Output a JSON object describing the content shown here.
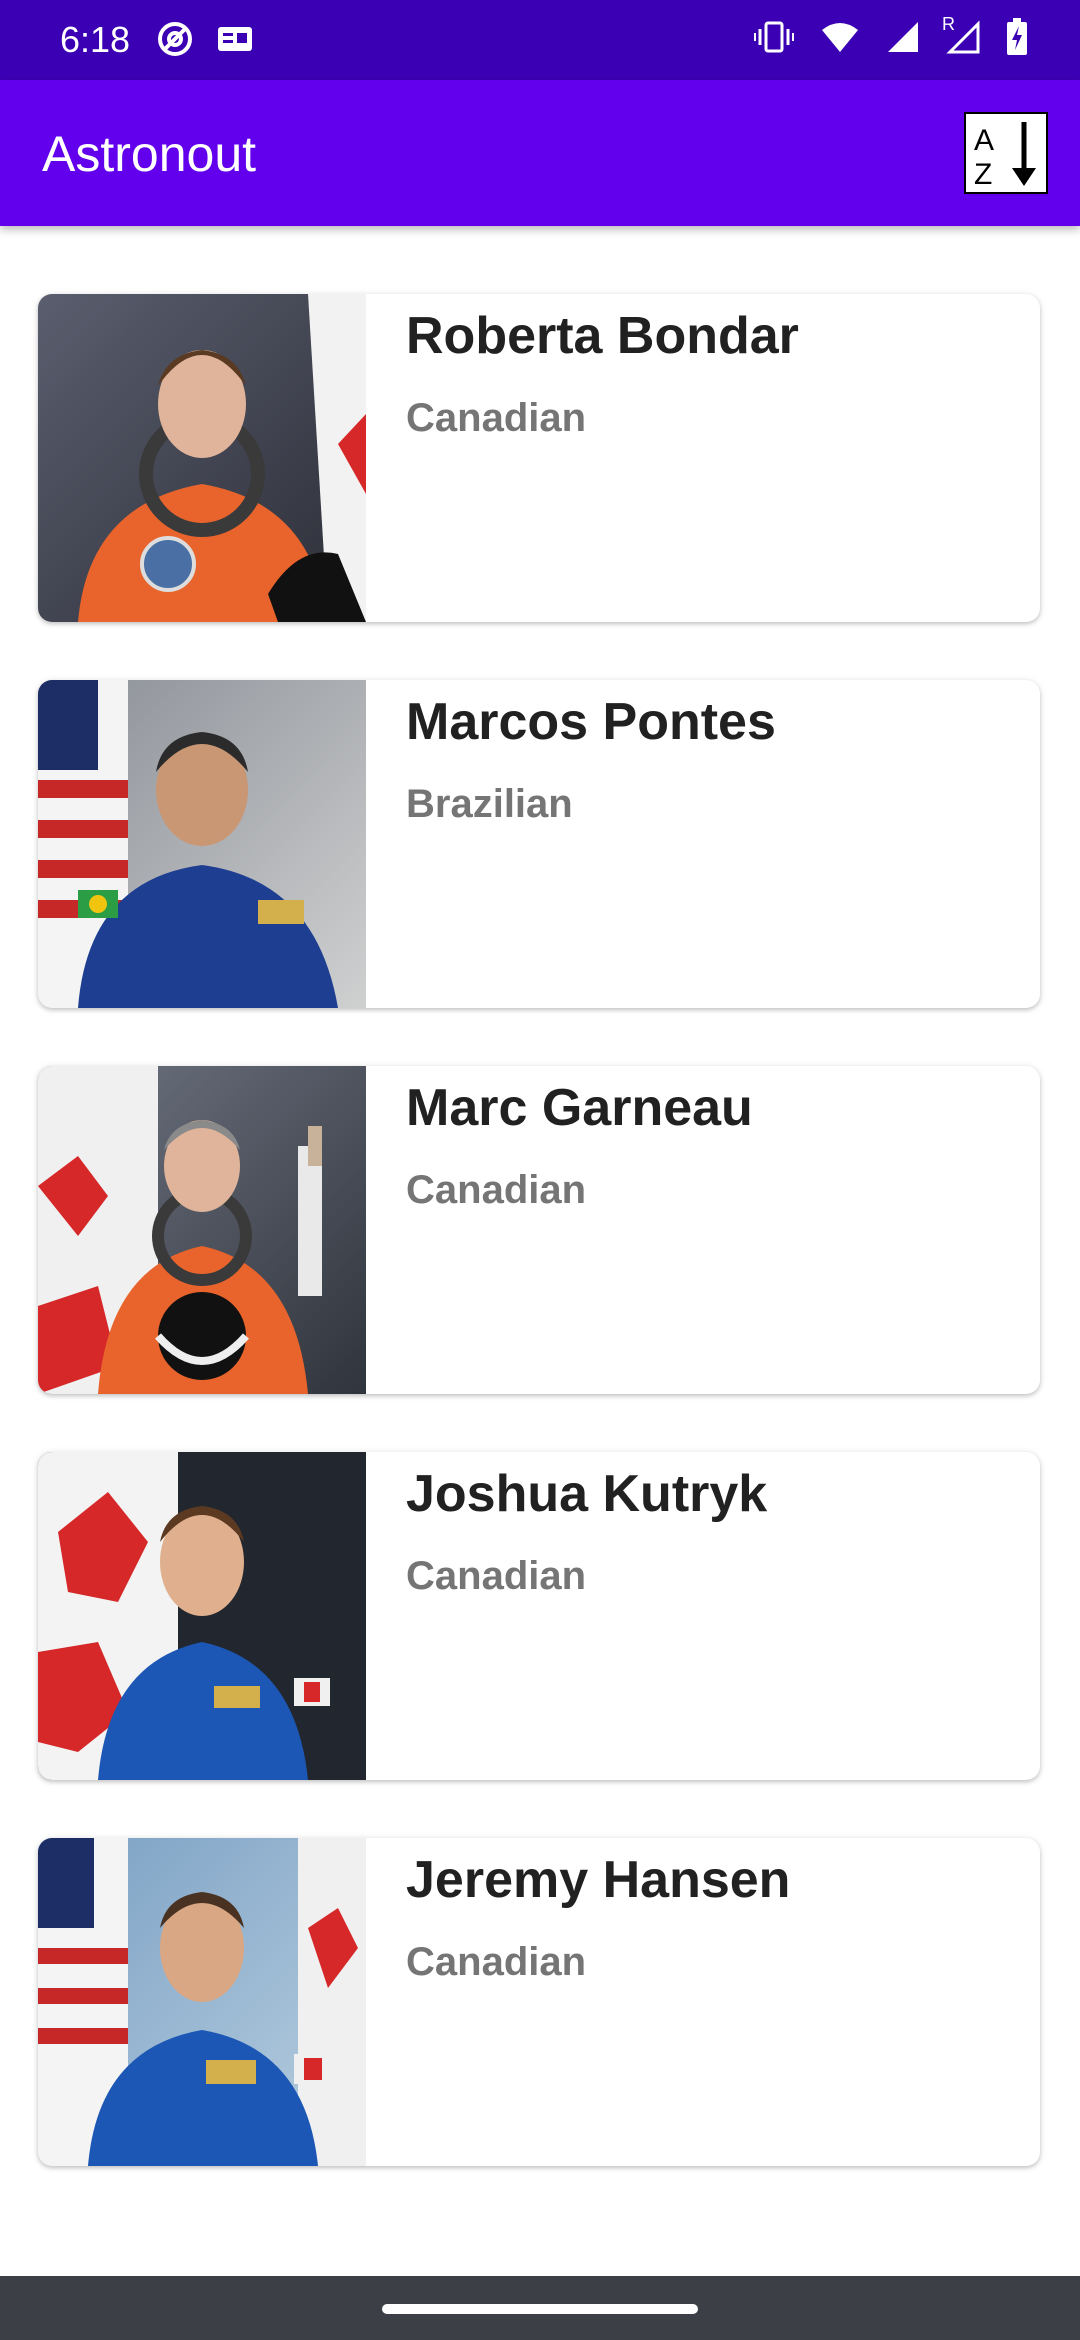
{
  "status_bar": {
    "time": "6:18",
    "left_icons": [
      "at-sign-icon",
      "gallery-icon"
    ],
    "right_icons": [
      "vibrate-icon",
      "wifi-icon",
      "cell-signal-icon",
      "cell-signal-roaming-icon",
      "battery-charging-icon"
    ],
    "roaming_label": "R"
  },
  "app_bar": {
    "title": "Astronout",
    "sort_icon": "sort-alpha-down-icon",
    "sort_letter_top": "A",
    "sort_letter_bottom": "Z"
  },
  "astronauts": [
    {
      "name": "Roberta Bondar",
      "nationality": "Canadian",
      "photo": "astronaut-orange-suit-canada-flag"
    },
    {
      "name": "Marcos Pontes",
      "nationality": "Brazilian",
      "photo": "astronaut-blue-suit-usa-flag"
    },
    {
      "name": "Marc Garneau",
      "nationality": "Canadian",
      "photo": "astronaut-orange-suit-helmet-canada-flag"
    },
    {
      "name": "Joshua Kutryk",
      "nationality": "Canadian",
      "photo": "astronaut-blue-suit-canada-flag"
    },
    {
      "name": "Jeremy Hansen",
      "nationality": "Canadian",
      "photo": "astronaut-blue-suit-usa-canada-flags"
    }
  ],
  "colors": {
    "status_bar": "#3b00b4",
    "app_bar": "#6200ee",
    "name_text": "#212121",
    "nationality_text": "#757575",
    "nav_bar": "#3c3f45"
  }
}
